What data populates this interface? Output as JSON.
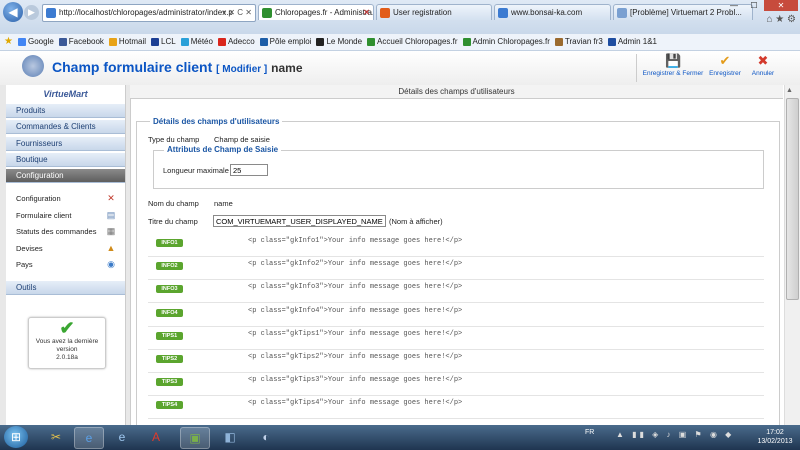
{
  "browser": {
    "url": "http://localhost/chloropages/administrator/index.p",
    "url_controls": "▾ ✕ C ✕",
    "tabs": [
      {
        "label": "Chloropages.fr - Administra...",
        "active": true,
        "fav_color": "#2f8f2f"
      },
      {
        "label": "User registration",
        "active": false,
        "fav_color": "#e25d1a"
      },
      {
        "label": "www.bonsai-ka.com",
        "active": false,
        "fav_color": "#3c7bd1"
      },
      {
        "label": "[Problème] Virtuemart 2 Probl...",
        "active": false,
        "fav_color": "#7aa0d1"
      }
    ],
    "window_controls": {
      "minimize": "—",
      "maximize": "☐",
      "close": "✕"
    },
    "right_icons": "⌂ ★ ⚙"
  },
  "favorites": [
    {
      "label": "Google",
      "color": "#4285f4"
    },
    {
      "label": "Facebook",
      "color": "#3b5998"
    },
    {
      "label": "Hotmail",
      "color": "#e8a317"
    },
    {
      "label": "LCL",
      "color": "#1c3f94"
    },
    {
      "label": "Météo",
      "color": "#2aa0d8"
    },
    {
      "label": "Adecco",
      "color": "#d9261c"
    },
    {
      "label": "Pôle emploi",
      "color": "#1d5ea8"
    },
    {
      "label": "Le Monde",
      "color": "#222222"
    },
    {
      "label": "Accueil Chloropages.fr",
      "color": "#2f8f2f"
    },
    {
      "label": "Admin Chloropages.fr",
      "color": "#2f8f2f"
    },
    {
      "label": "Travian fr3",
      "color": "#9b6a2e"
    },
    {
      "label": "Admin 1&1",
      "color": "#1f4ea1"
    }
  ],
  "header": {
    "title": "Champ formulaire client",
    "subtitle": "[ Modifier ]",
    "name": "name",
    "buttons": [
      {
        "label": "Enregistrer & Fermer",
        "icon": "💾",
        "color": "#555555"
      },
      {
        "label": "Enregistrer",
        "icon": "✔",
        "color": "#e39b1a"
      },
      {
        "label": "Annuler",
        "icon": "✖",
        "color": "#d33a2c"
      }
    ]
  },
  "sidebar": {
    "logo_text": "VirtueMart",
    "sections": [
      {
        "label": "Produits",
        "active": false
      },
      {
        "label": "Commandes & Clients",
        "active": false
      },
      {
        "label": "Fournisseurs",
        "active": false
      },
      {
        "label": "Boutique",
        "active": false
      },
      {
        "label": "Configuration",
        "active": true
      }
    ],
    "config_items": [
      {
        "label": "Configuration",
        "icon": "✕"
      },
      {
        "label": "Formulaire client",
        "icon": "▤"
      },
      {
        "label": "Statuts des commandes",
        "icon": "▦"
      },
      {
        "label": "Devises",
        "icon": "▲"
      },
      {
        "label": "Pays",
        "icon": "◉"
      }
    ],
    "tools_label": "Outils",
    "version_box": {
      "line1": "Vous avez la dernière",
      "line2": "version",
      "version": "2.0.18a"
    }
  },
  "main": {
    "header": "Détails des champs d'utilisateurs",
    "legend": "Détails des champs d'utilisateurs",
    "field_type_label": "Type du champ",
    "field_type_value": "Champ de saisie",
    "attributes_legend": "Attributs de Champ de Saisie",
    "max_length_label": "Longueur maximale",
    "max_length_value": "25",
    "field_name_label": "Nom du champ",
    "field_name_value": "name",
    "field_title_label": "Titre du champ",
    "field_title_value": "COM_VIRTUEMART_USER_DISPLAYED_NAME",
    "field_title_hint": "(Nom à afficher)",
    "info_rows": [
      {
        "badge": "INFO1",
        "code": "<p class=\"gkInfo1\">Your info message goes here!</p>"
      },
      {
        "badge": "INFO2",
        "code": "<p class=\"gkInfo2\">Your info message goes here!</p>"
      },
      {
        "badge": "INFO3",
        "code": "<p class=\"gkInfo3\">Your info message goes here!</p>"
      },
      {
        "badge": "INFO4",
        "code": "<p class=\"gkInfo4\">Your info message goes here!</p>"
      },
      {
        "badge": "TIPS1",
        "code": "<p class=\"gkTips1\">Your info message goes here!</p>"
      },
      {
        "badge": "TIPS2",
        "code": "<p class=\"gkTips2\">Your info message goes here!</p>"
      },
      {
        "badge": "TIPS3",
        "code": "<p class=\"gkTips3\">Your info message goes here!</p>"
      },
      {
        "badge": "TIPS4",
        "code": "<p class=\"gkTips4\">Your info message goes here!</p>"
      }
    ]
  },
  "taskbar": {
    "start_icon": "⊞",
    "apps": [
      {
        "name": "ie-compat-icon",
        "glyph": "✂",
        "on": false
      },
      {
        "name": "internet-explorer-icon",
        "glyph": "e",
        "on": true
      },
      {
        "name": "ie-alt-icon",
        "glyph": "e",
        "on": false
      },
      {
        "name": "pdf-icon",
        "glyph": "A",
        "on": false
      },
      {
        "name": "editor-icon",
        "glyph": "▣",
        "on": true
      },
      {
        "name": "tablet-icon",
        "glyph": "◧",
        "on": false
      },
      {
        "name": "app-icon",
        "glyph": "◐",
        "on": false
      }
    ],
    "language": "FR",
    "tray_icons": "▲ ▮▮ ◈ ♪ ▣ ⚑ ◉ ◆",
    "time": "17:02",
    "date": "13/02/2013"
  }
}
